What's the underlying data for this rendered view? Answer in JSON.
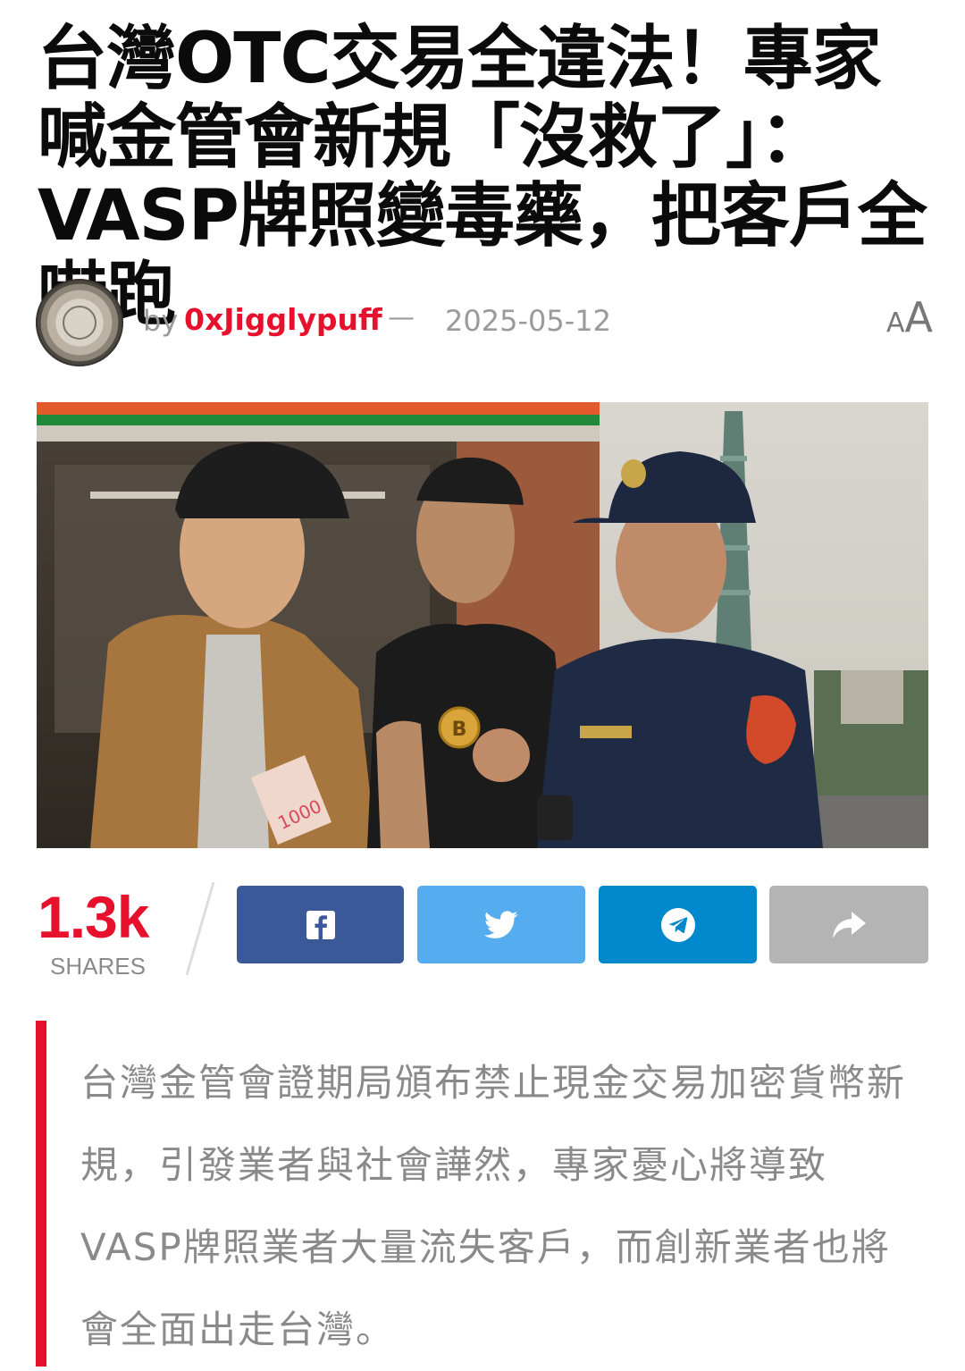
{
  "article": {
    "headline": "台灣OTC交易全違法！專家喊金管會新規「沒救了」：VASP牌照變毒藥，把客戶全嚇跑",
    "byline_prefix": "by",
    "author": "0xJigglypuff",
    "separator": "—",
    "date": "2025-05-12",
    "font_toggle_small": "A",
    "font_toggle_big": "A",
    "excerpt": "台灣金管會證期局頒布禁止現金交易加密貨幣新規，引發業者與社會譁然，專家憂心將導致VASP牌照業者大量流失客戶，而創新業者也將會全面出走台灣。"
  },
  "share": {
    "count": "1.3k",
    "label": "SHARES",
    "buttons": [
      {
        "name": "facebook",
        "icon": "facebook-icon",
        "color": "#3b5998"
      },
      {
        "name": "twitter",
        "icon": "twitter-icon",
        "color": "#55acee"
      },
      {
        "name": "telegram",
        "icon": "telegram-icon",
        "color": "#0088cc"
      },
      {
        "name": "more",
        "icon": "share-arrow-icon",
        "color": "#b4b4b4"
      }
    ]
  },
  "hero_image": {
    "coin_letter": "B",
    "banknote_text": "1000"
  },
  "colors": {
    "accent": "#e8112d",
    "meta_gray": "#9a9a9a"
  }
}
